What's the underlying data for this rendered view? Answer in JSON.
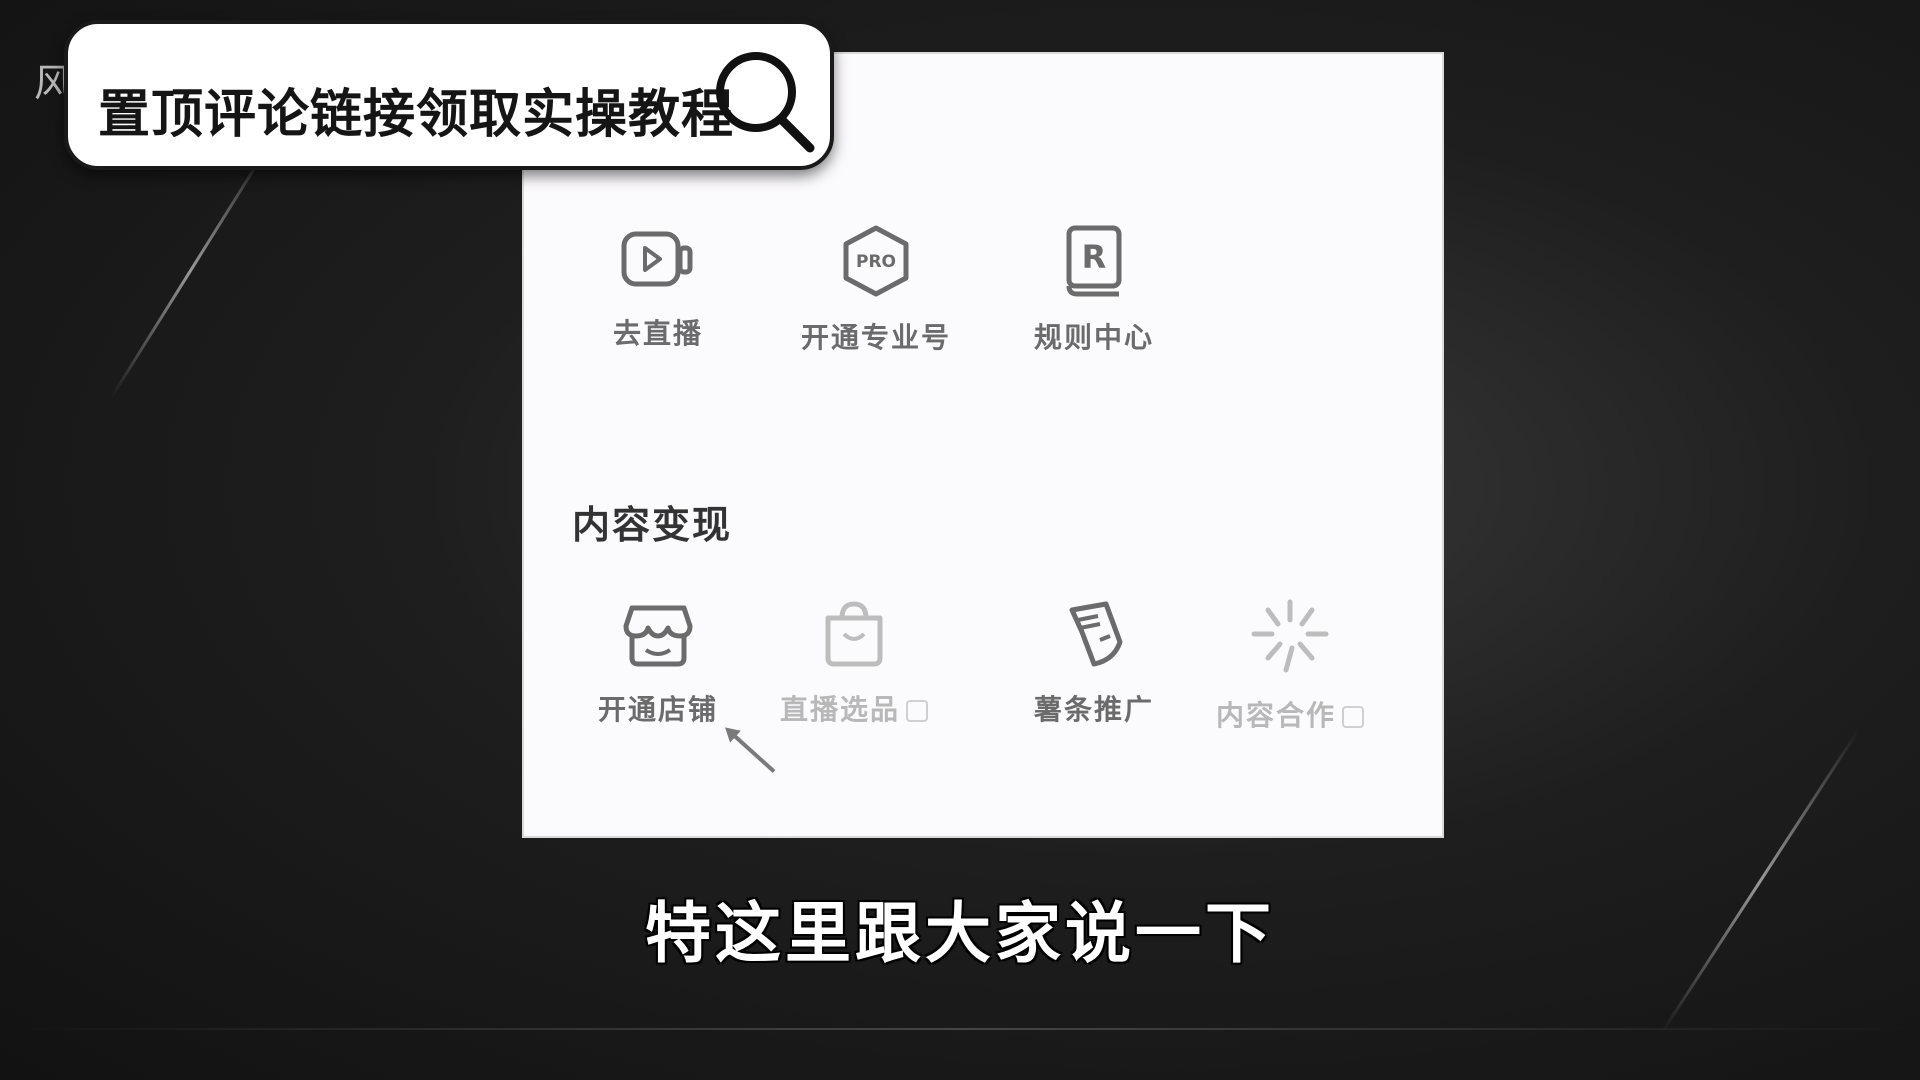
{
  "corner_text": "风",
  "banner": {
    "title": "置顶评论链接领取实操教程",
    "icon": "search-icon"
  },
  "tools": [
    {
      "label": "去直播",
      "icon": "live-camera-icon"
    },
    {
      "label": "开通专业号",
      "icon": "pro-badge-icon"
    },
    {
      "label": "规则中心",
      "icon": "rules-book-icon"
    }
  ],
  "monetization": {
    "title": "内容变现",
    "items": [
      {
        "label": "开通店铺",
        "icon": "shop-icon"
      },
      {
        "label": "直播选品",
        "icon": "shopping-bag-icon"
      },
      {
        "label": "薯条推广",
        "icon": "fries-icon"
      },
      {
        "label": "内容合作",
        "icon": "sparkle-icon"
      }
    ]
  },
  "subtitle": "特这里跟大家说一下",
  "colors": {
    "panel_bg": "#fbfafc",
    "banner_bg": "#ffffff",
    "label_gray": "#6b6b6b",
    "dim_gray": "#b8b8b8"
  }
}
